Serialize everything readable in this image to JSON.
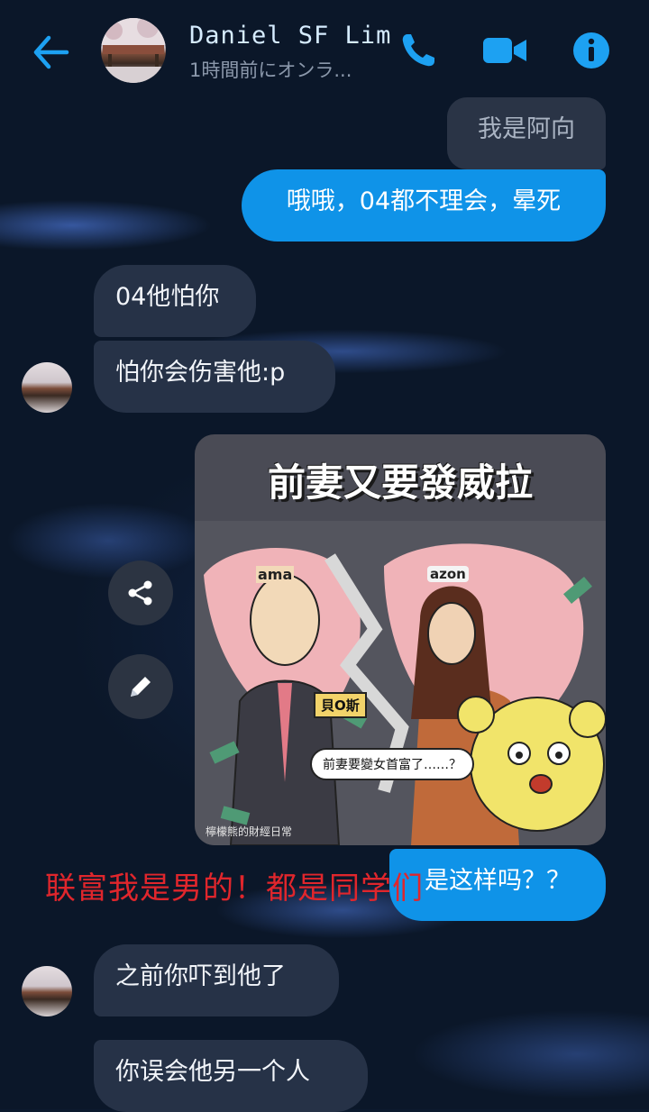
{
  "header": {
    "contact_name": "Daniel SF Lim",
    "status": "1時間前にオンラ...",
    "accent_color": "#1da1f2",
    "icons": [
      "back-arrow-icon",
      "phone-icon",
      "video-camera-icon",
      "info-icon"
    ]
  },
  "messages": [
    {
      "side": "out",
      "style": "faded",
      "text": "我是阿向"
    },
    {
      "side": "out",
      "text": "哦哦，04都不理会，晕死"
    },
    {
      "side": "in",
      "text": "04他怕你"
    },
    {
      "side": "in",
      "text": "怕你会伤害他:p"
    },
    {
      "side": "out",
      "text": "是这样吗？？"
    },
    {
      "side": "in",
      "text": "之前你吓到他了"
    },
    {
      "side": "in",
      "text": "你误会他另一个人"
    }
  ],
  "image_message": {
    "title": "前妻又要發威拉",
    "name_tag": "貝O斯",
    "speech": "前妻要變女首富了……？",
    "brand_left": "ama",
    "brand_right": "azon",
    "credit": "檸檬熊的財經日常"
  },
  "overlay_text": "联富我是男的！都是同学们",
  "side_actions": [
    "share-icon",
    "edit-pencil-icon"
  ]
}
